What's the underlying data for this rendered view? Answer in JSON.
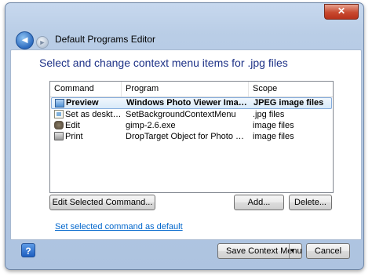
{
  "window": {
    "close_symbol": "✕",
    "close_button_color": "#c8492f"
  },
  "nav": {
    "back_symbol": "◄",
    "forward_symbol": "►",
    "title": "Default Programs Editor"
  },
  "content": {
    "heading": "Select and change context menu items for .jpg files",
    "heading_color": "#1e3287"
  },
  "list": {
    "columns": [
      "Command",
      "Program",
      "Scope"
    ],
    "rows": [
      {
        "command": "Preview",
        "program": "Windows Photo Viewer Image Verbs",
        "scope": "JPEG image files",
        "icon": "photo-viewer-icon",
        "selected": true
      },
      {
        "command": "Set as desktop ...",
        "program": "SetBackgroundContextMenu",
        "scope": ".jpg files",
        "icon": "desktop-background-icon",
        "selected": false
      },
      {
        "command": "Edit",
        "program": "gimp-2.6.exe",
        "scope": "image files",
        "icon": "gimp-icon",
        "selected": false
      },
      {
        "command": "Print",
        "program": "DropTarget Object for Photo Printing...",
        "scope": "image files",
        "icon": "printer-icon",
        "selected": false
      }
    ]
  },
  "buttons": {
    "edit_selected": "Edit Selected Command...",
    "add": "Add...",
    "delete": "Delete...",
    "save_context_menu": "Save Context Menu",
    "cancel": "Cancel",
    "dropdown_symbol": "▼",
    "help_symbol": "?"
  },
  "link": {
    "set_default": "Set selected command as default",
    "color": "#0066cc"
  }
}
